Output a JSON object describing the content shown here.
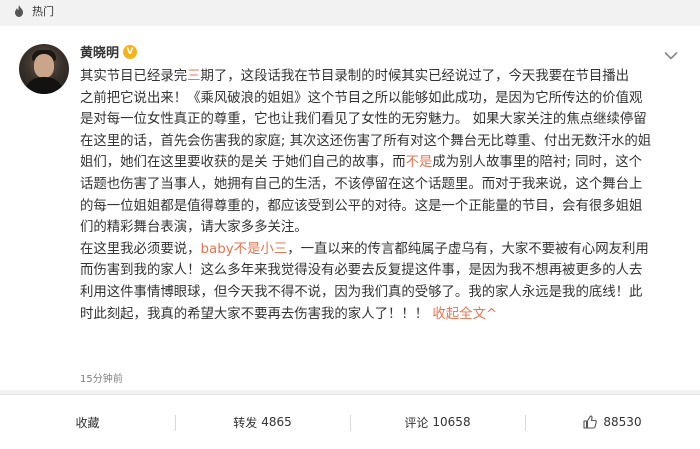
{
  "topbar": {
    "icon": "flame-icon",
    "label": "热门"
  },
  "user": {
    "name": "黄晓明",
    "verified": "V"
  },
  "post": {
    "lines": [
      [
        {
          "t": "其实节目已经录完"
        },
        {
          "t": "三",
          "red": true
        },
        {
          "t": "期了，这段话我在节目录制的时候其实已经说过了，今天我要在节目播出"
        }
      ],
      [
        {
          "t": "之前把它说出来！《乘风破浪的姐姐》这个节目之所以能够如此成功，是因为它所传达的价值观"
        }
      ],
      [
        {
          "t": "是对每一位女性真正的尊重，它也让我们看见了女性的无穷魅力。 如果大家关注的焦点继续停留"
        }
      ],
      [
        {
          "t": "在这里的话，首先会伤害我的家庭; 其次这还伤害了所有对这个舞台无比尊重、付出无数汗水的姐"
        }
      ],
      [
        {
          "t": "姐们，她们在这里要收获的是关 于她们自己的故事，而"
        },
        {
          "t": "不是",
          "red": true
        },
        {
          "t": "成为别人故事里的陪衬; 同时，这个"
        }
      ],
      [
        {
          "t": "话题也伤害了当事人，她拥有自己的生活，不该停留在这个话题里。而对于我来说，这个舞台上"
        }
      ],
      [
        {
          "t": "的每一位姐姐都是值得尊重的，都应该受到公平的对待。这是一个正能量的节目，会有很多姐姐"
        }
      ],
      [
        {
          "t": "们的精彩舞台表演，请大家多多关注。"
        }
      ],
      [
        {
          "t": "在这里我必须要说，"
        },
        {
          "t": "baby不是小三",
          "red": true
        },
        {
          "t": "，一直以来的传言都纯属子虚乌有，大家不要被有心网友利用"
        }
      ],
      [
        {
          "t": "而伤害到我的家人！这么多年来我觉得没有必要去反复提这件事，是因为我不想再被更多的人去"
        }
      ],
      [
        {
          "t": "利用这件事情博眼球，但今天我不得不说，因为我们真的受够了。我的家人永远是我的底线！此"
        }
      ],
      [
        {
          "t": "时此刻起，我真的希望大家不要再去伤害我的家人了！！！ "
        },
        {
          "t": "收起全文",
          "link": true
        },
        {
          "t": "^",
          "arrow": true
        }
      ]
    ],
    "time": "15分钟前"
  },
  "actions": {
    "favorite": {
      "label": "收藏"
    },
    "repost": {
      "label": "转发",
      "count": "4865"
    },
    "comment": {
      "label": "评论",
      "count": "10658"
    },
    "like": {
      "icon": "thumbs-up-icon",
      "count": "88530"
    }
  },
  "colors": {
    "accent": "#eb7350",
    "verified": "#f7b21a",
    "text": "#333333",
    "muted": "#808080"
  }
}
